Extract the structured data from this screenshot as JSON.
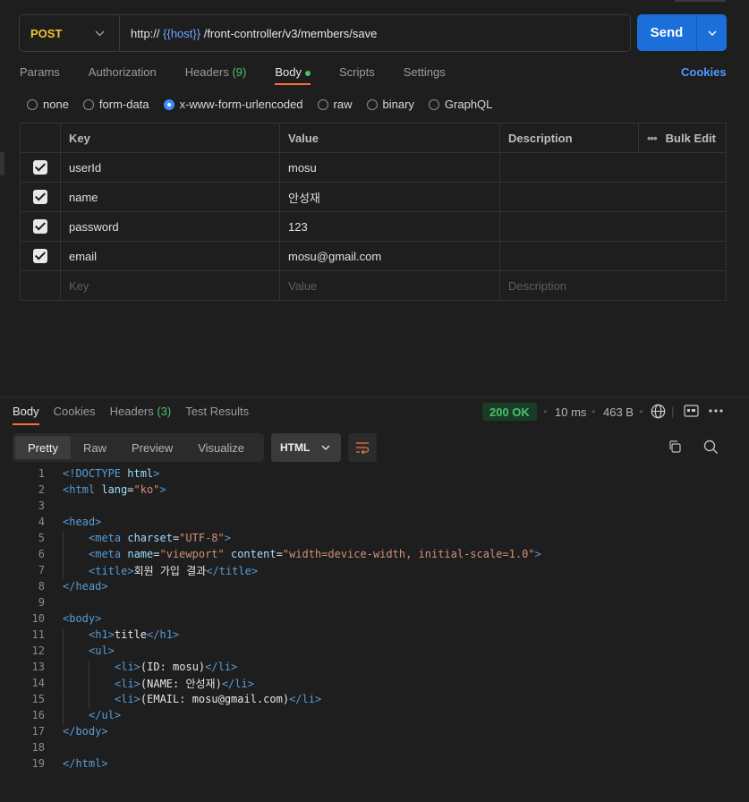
{
  "request": {
    "method": "POST",
    "url_prefix": "http:// ",
    "url_variable": "{{host}}",
    "url_path": " /front-controller/v3/members/save",
    "send_label": "Send"
  },
  "request_tabs": [
    {
      "label": "Params"
    },
    {
      "label": "Authorization"
    },
    {
      "label": "Headers",
      "count": "(9)"
    },
    {
      "label": "Body"
    },
    {
      "label": "Scripts"
    },
    {
      "label": "Settings"
    }
  ],
  "cookies_label": "Cookies",
  "body_types": [
    "none",
    "form-data",
    "x-www-form-urlencoded",
    "raw",
    "binary",
    "GraphQL"
  ],
  "selected_body_type": "x-www-form-urlencoded",
  "params_table": {
    "headers": {
      "key": "Key",
      "value": "Value",
      "description": "Description",
      "bulk_edit": "Bulk Edit"
    },
    "rows": [
      {
        "key": "userId",
        "value": "mosu",
        "checked": true
      },
      {
        "key": "name",
        "value": "안성재",
        "checked": true
      },
      {
        "key": "password",
        "value": "123",
        "checked": true
      },
      {
        "key": "email",
        "value": "mosu@gmail.com",
        "checked": true
      }
    ],
    "placeholders": {
      "key": "Key",
      "value": "Value",
      "description": "Description"
    }
  },
  "response_tabs": [
    {
      "label": "Body"
    },
    {
      "label": "Cookies"
    },
    {
      "label": "Headers",
      "count": "(3)"
    },
    {
      "label": "Test Results"
    }
  ],
  "response_meta": {
    "status": "200 OK",
    "time": "10 ms",
    "size": "463 B"
  },
  "view_modes": [
    "Pretty",
    "Raw",
    "Preview",
    "Visualize"
  ],
  "language": "HTML",
  "code_lines": [
    {
      "n": "1",
      "indent": 0,
      "parts": [
        [
          "tg",
          "<!DOCTYPE "
        ],
        [
          "at",
          "html"
        ],
        [
          "tg",
          ">"
        ]
      ]
    },
    {
      "n": "2",
      "indent": 0,
      "parts": [
        [
          "tg",
          "<html "
        ],
        [
          "at",
          "lang"
        ],
        [
          "tx",
          "="
        ],
        [
          "st",
          "\"ko\""
        ],
        [
          "tg",
          ">"
        ]
      ]
    },
    {
      "n": "3",
      "indent": 0,
      "parts": []
    },
    {
      "n": "4",
      "indent": 0,
      "parts": [
        [
          "tg",
          "<head>"
        ]
      ]
    },
    {
      "n": "5",
      "indent": 1,
      "parts": [
        [
          "tg",
          "<meta "
        ],
        [
          "at",
          "charset"
        ],
        [
          "tx",
          "="
        ],
        [
          "st",
          "\"UTF-8\""
        ],
        [
          "tg",
          ">"
        ]
      ]
    },
    {
      "n": "6",
      "indent": 1,
      "parts": [
        [
          "tg",
          "<meta "
        ],
        [
          "at",
          "name"
        ],
        [
          "tx",
          "="
        ],
        [
          "st",
          "\"viewport\""
        ],
        [
          "tx",
          " "
        ],
        [
          "at",
          "content"
        ],
        [
          "tx",
          "="
        ],
        [
          "st",
          "\"width=device-width, initial-scale=1.0\""
        ],
        [
          "tg",
          ">"
        ]
      ]
    },
    {
      "n": "7",
      "indent": 1,
      "parts": [
        [
          "tg",
          "<title>"
        ],
        [
          "tx",
          "회원 가입 결과"
        ],
        [
          "tg",
          "</title>"
        ]
      ]
    },
    {
      "n": "8",
      "indent": 0,
      "parts": [
        [
          "tg",
          "</head>"
        ]
      ]
    },
    {
      "n": "9",
      "indent": 0,
      "parts": []
    },
    {
      "n": "10",
      "indent": 0,
      "parts": [
        [
          "tg",
          "<body>"
        ]
      ]
    },
    {
      "n": "11",
      "indent": 1,
      "parts": [
        [
          "tg",
          "<h1>"
        ],
        [
          "tx",
          "title"
        ],
        [
          "tg",
          "</h1>"
        ]
      ]
    },
    {
      "n": "12",
      "indent": 1,
      "parts": [
        [
          "tg",
          "<ul>"
        ]
      ]
    },
    {
      "n": "13",
      "indent": 2,
      "parts": [
        [
          "tg",
          "<li>"
        ],
        [
          "tx",
          "(ID: mosu)"
        ],
        [
          "tg",
          "</li>"
        ]
      ]
    },
    {
      "n": "14",
      "indent": 2,
      "parts": [
        [
          "tg",
          "<li>"
        ],
        [
          "tx",
          "(NAME: 안성재)"
        ],
        [
          "tg",
          "</li>"
        ]
      ]
    },
    {
      "n": "15",
      "indent": 2,
      "parts": [
        [
          "tg",
          "<li>"
        ],
        [
          "tx",
          "(EMAIL: mosu@gmail.com)"
        ],
        [
          "tg",
          "</li>"
        ]
      ]
    },
    {
      "n": "16",
      "indent": 1,
      "parts": [
        [
          "tg",
          "</ul>"
        ]
      ]
    },
    {
      "n": "17",
      "indent": 0,
      "parts": [
        [
          "tg",
          "</body>"
        ]
      ]
    },
    {
      "n": "18",
      "indent": 0,
      "parts": []
    },
    {
      "n": "19",
      "indent": 0,
      "parts": [
        [
          "tg",
          "</html>"
        ]
      ]
    }
  ],
  "colors": {
    "accent": "#ff6c37",
    "send_button": "#1a6fd9",
    "method_post": "#f2c230",
    "status_ok": "#4ec06a",
    "link_blue": "#4c9bff"
  }
}
